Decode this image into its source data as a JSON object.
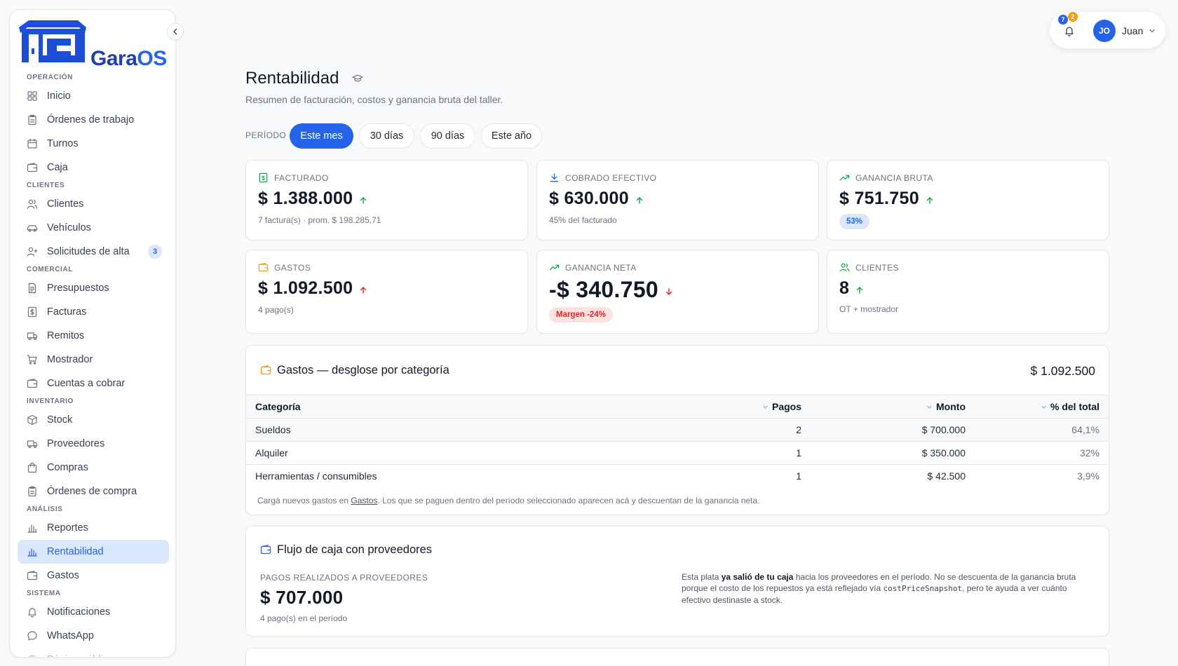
{
  "app": {
    "logo_main": "Gara",
    "logo_os": "OS"
  },
  "sidebar": {
    "sections": [
      {
        "title": "OPERACIÓN",
        "items": [
          {
            "label": "Inicio",
            "icon": "grid-icon"
          },
          {
            "label": "Órdenes de trabajo",
            "icon": "clipboard-icon"
          },
          {
            "label": "Turnos",
            "icon": "calendar-icon"
          },
          {
            "label": "Caja",
            "icon": "wallet-icon"
          }
        ]
      },
      {
        "title": "CLIENTES",
        "items": [
          {
            "label": "Clientes",
            "icon": "users-icon"
          },
          {
            "label": "Vehículos",
            "icon": "car-icon"
          },
          {
            "label": "Solicitudes de alta",
            "icon": "user-plus-icon",
            "badge": "3"
          }
        ]
      },
      {
        "title": "COMERCIAL",
        "items": [
          {
            "label": "Presupuestos",
            "icon": "document-icon"
          },
          {
            "label": "Facturas",
            "icon": "receipt-icon"
          },
          {
            "label": "Remitos",
            "icon": "truck-icon"
          },
          {
            "label": "Mostrador",
            "icon": "cart-icon"
          },
          {
            "label": "Cuentas a cobrar",
            "icon": "wallet-icon"
          }
        ]
      },
      {
        "title": "INVENTARIO",
        "items": [
          {
            "label": "Stock",
            "icon": "box-icon"
          },
          {
            "label": "Proveedores",
            "icon": "truck-icon"
          },
          {
            "label": "Compras",
            "icon": "bag-icon"
          },
          {
            "label": "Órdenes de compra",
            "icon": "clipboard-icon"
          }
        ]
      },
      {
        "title": "ANÁLISIS",
        "items": [
          {
            "label": "Reportes",
            "icon": "bar-chart-icon"
          },
          {
            "label": "Rentabilidad",
            "icon": "bar-chart-icon",
            "active": true
          },
          {
            "label": "Gastos",
            "icon": "wallet-icon"
          }
        ]
      },
      {
        "title": "SISTEMA",
        "items": [
          {
            "label": "Notificaciones",
            "icon": "bell-icon"
          },
          {
            "label": "WhatsApp",
            "icon": "chat-icon"
          },
          {
            "label": "Página pública",
            "icon": "globe-icon"
          }
        ]
      }
    ]
  },
  "topbar": {
    "notif_count_blue": "7",
    "notif_count_orange": "2",
    "avatar_initials": "JO",
    "user_name": "Juan"
  },
  "page": {
    "title": "Rentabilidad",
    "subtitle": "Resumen de facturación, costos y ganancia bruta del taller."
  },
  "period": {
    "label": "PERÍODO",
    "options": [
      "Este mes",
      "30 días",
      "90 días",
      "Este año"
    ],
    "selected": "Este mes"
  },
  "stats": {
    "facturado": {
      "label": "FACTURADO",
      "value": "$ 1.388.000",
      "sub": "7 factura(s) · prom. $ 198.285,71"
    },
    "cobrado": {
      "label": "COBRADO EFECTIVO",
      "value": "$ 630.000",
      "sub": "45% del facturado"
    },
    "ganancia_bruta": {
      "label": "GANANCIA BRUTA",
      "value": "$ 751.750",
      "chip": "53%"
    },
    "gastos": {
      "label": "GASTOS",
      "value": "$ 1.092.500",
      "sub": "4 pago(s)"
    },
    "ganancia_neta": {
      "label": "GANANCIA NETA",
      "value": "-$ 340.750",
      "chip": "Margen -24%"
    },
    "clientes": {
      "label": "CLIENTES",
      "value": "8",
      "sub": "OT + mostrador"
    }
  },
  "colors": {
    "accent": "#2563eb",
    "positive": "#16a34a",
    "negative": "#dc2626",
    "warning": "#f59e0b"
  },
  "expenses": {
    "title": "Gastos — desglose por categoría",
    "total": "$ 1.092.500",
    "columns": {
      "category": "Categoría",
      "payments": "Pagos",
      "amount": "Monto",
      "percent": "% del total"
    },
    "rows": [
      {
        "category": "Sueldos",
        "payments": "2",
        "amount": "$ 700.000",
        "percent": "64,1%"
      },
      {
        "category": "Alquiler",
        "payments": "1",
        "amount": "$ 350.000",
        "percent": "32%"
      },
      {
        "category": "Herramientas / consumibles",
        "payments": "1",
        "amount": "$ 42.500",
        "percent": "3,9%"
      }
    ],
    "note_before": "Cargá nuevos gastos en ",
    "note_link": "Gastos",
    "note_after": ". Los que se paguen dentro del período seleccionado aparecen acá y descuentan de la ganancia neta."
  },
  "cashflow": {
    "title": "Flujo de caja con proveedores",
    "label": "PAGOS REALIZADOS A PROVEEDORES",
    "value": "$ 707.000",
    "sub": "4 pago(s) en el período",
    "note_1": "Esta plata ",
    "note_bold": "ya salió de tu caja",
    "note_2": " hacia los proveedores en el período. No se descuenta de la ganancia bruta porque el costo de los repuestos ya está reflejado vía ",
    "note_code": "costPriceSnapshot",
    "note_3": ", pero te ayuda a ver cuánto efectivo destinaste a stock."
  }
}
